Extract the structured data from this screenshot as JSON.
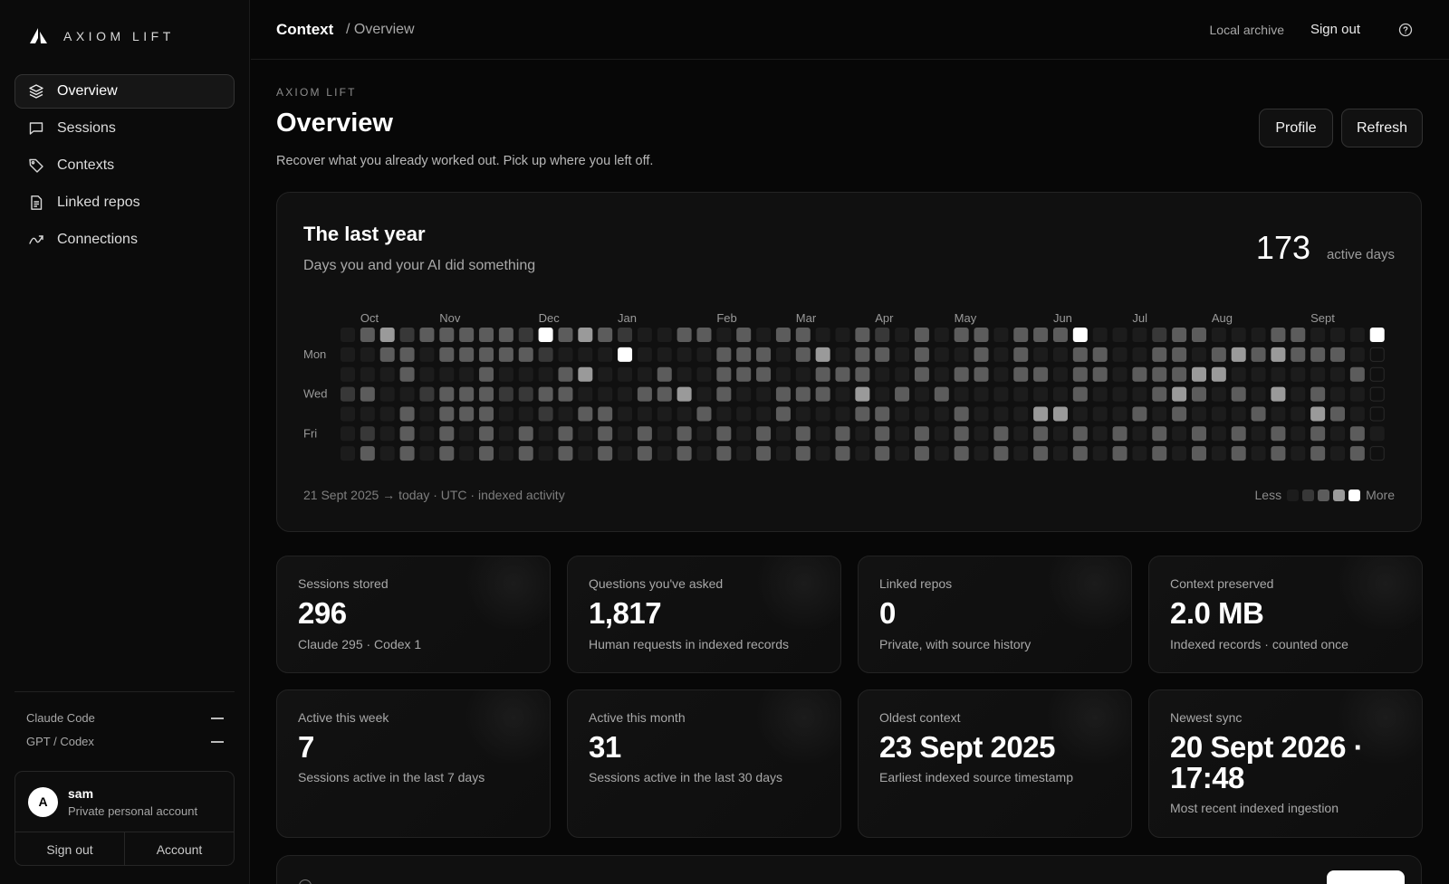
{
  "brand": {
    "name": "AXIOM LIFT"
  },
  "sidebar": {
    "items": [
      {
        "label": "Overview",
        "icon": "layers-icon",
        "active": true
      },
      {
        "label": "Sessions",
        "icon": "chat-icon"
      },
      {
        "label": "Contexts",
        "icon": "tag-icon"
      },
      {
        "label": "Linked repos",
        "icon": "document-icon"
      },
      {
        "label": "Connections",
        "icon": "link-icon"
      }
    ],
    "integrations": [
      {
        "name": "Claude Code",
        "status": "—"
      },
      {
        "name": "GPT / Codex",
        "status": "—"
      }
    ],
    "account": {
      "initial": "A",
      "name": "sam",
      "subtitle": "Private personal account",
      "signout_label": "Sign out",
      "account_label": "Account"
    }
  },
  "topbar": {
    "context": "Context",
    "page": "/ Overview",
    "archive": "Local archive",
    "signout": "Sign out",
    "help_icon": "question-circle-icon"
  },
  "main": {
    "eyebrow": "AXIOM LIFT",
    "title": "Overview",
    "subtitle": "Recover what you already worked out. Pick up where you left off.",
    "profile_label": "Profile",
    "refresh_label": "Refresh"
  },
  "heatmap": {
    "title": "The last year",
    "subtitle": "Days you and your AI did something",
    "active_days": "173",
    "active_days_label": "active days",
    "months": [
      "Oct",
      "Nov",
      "Dec",
      "Jan",
      "Feb",
      "Mar",
      "Apr",
      "May",
      "Jun",
      "Jul",
      "Aug",
      "Sept"
    ],
    "day_labels": [
      "Mon",
      "Wed",
      "Fri"
    ],
    "footer": "21 Sept 2025 → today · UTC · indexed activity",
    "legend_less": "Less",
    "legend_more": "More",
    "colors": [
      "#1c1c1c",
      "#383838",
      "#5c5c5c",
      "#9a9a9a",
      "#ffffff"
    ],
    "grid": [
      "0231222221423210022020220021020220222400012200022000401222222200220000220220022320000000002001020201020200002001030200002001020",
      "0022022222100040000222023022020020200220022023232220023200232031020013310030020000220011002220000020220400230022030032030000300",
      "0002000200023000200222002220020220220220222330000002000200300232002000330022000300020022003000230020340020402000002003020000020",
      "1200122211220002230200222030202000000200023202030200200300200202203320200033202002000020002300030220020002033300003000301000003",
      "0002022200102200002000200022000200033000202000200320000002000330200000320002302030302000230230000000033320002003000200020000003",
      "0102020202020202020202020202020202020202020202020202020202020202020202020202020202020202020202020202020202020202020202020202020",
      "0202020202020202020202020202020202020202020202020202020202020202020202020202020202020202020202020202020202020202020202020202020"
    ]
  },
  "stats": [
    {
      "label": "Sessions stored",
      "value": "296",
      "note": "Claude 295 · Codex 1"
    },
    {
      "label": "Questions you've asked",
      "value": "1,817",
      "note": "Human requests in indexed records"
    },
    {
      "label": "Linked repos",
      "value": "0",
      "note": "Private, with source history"
    },
    {
      "label": "Context preserved",
      "value": "2.0 MB",
      "note": "Indexed records · counted once"
    },
    {
      "label": "Active this week",
      "value": "7",
      "note": "Sessions active in the last 7 days"
    },
    {
      "label": "Active this month",
      "value": "31",
      "note": "Sessions active in the last 30 days"
    },
    {
      "label": "Oldest context",
      "value": "23 Sept 2025",
      "note": "Earliest indexed source timestamp"
    },
    {
      "label": "Newest sync",
      "value": "20 Sept 2026 ·\n17:48",
      "note": "Most recent indexed ingestion"
    }
  ]
}
